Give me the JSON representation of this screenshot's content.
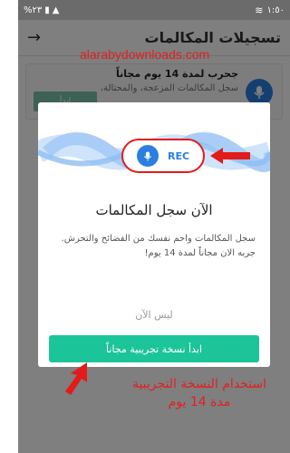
{
  "status_bar": {
    "time": "١:٥٠",
    "battery": "%٢٣",
    "wifi_icon": "wifi-icon"
  },
  "app_bar": {
    "title": "تسجيلات المكالمات",
    "back_icon": "arrow-back-icon"
  },
  "watermark": "alarabydownloads.com",
  "background_card": {
    "title": "جحرب لمدة 14 يوم مجاناً",
    "description": "سجل المكالمات المزعجة، والمحتالة،",
    "button_label": "ابدأ"
  },
  "dialog": {
    "rec_label": "REC",
    "title": "الآن سجل المكالمات",
    "description": "سجل المكالمات واحم نفسك من الفضائح والتحرش. جربه الان مجاناً لمدة 14 يوم!",
    "not_now": "ليس الآن",
    "trial_button": "ابدأ نسخة تجريبية مجاناً"
  },
  "annotation": {
    "line1": "استخدام النسخة التجريبية",
    "line2": "مدة 14 يوم"
  },
  "colors": {
    "accent_blue": "#2a7fe0",
    "trial_green": "#1cc49a",
    "annotation_red": "#e02020"
  }
}
